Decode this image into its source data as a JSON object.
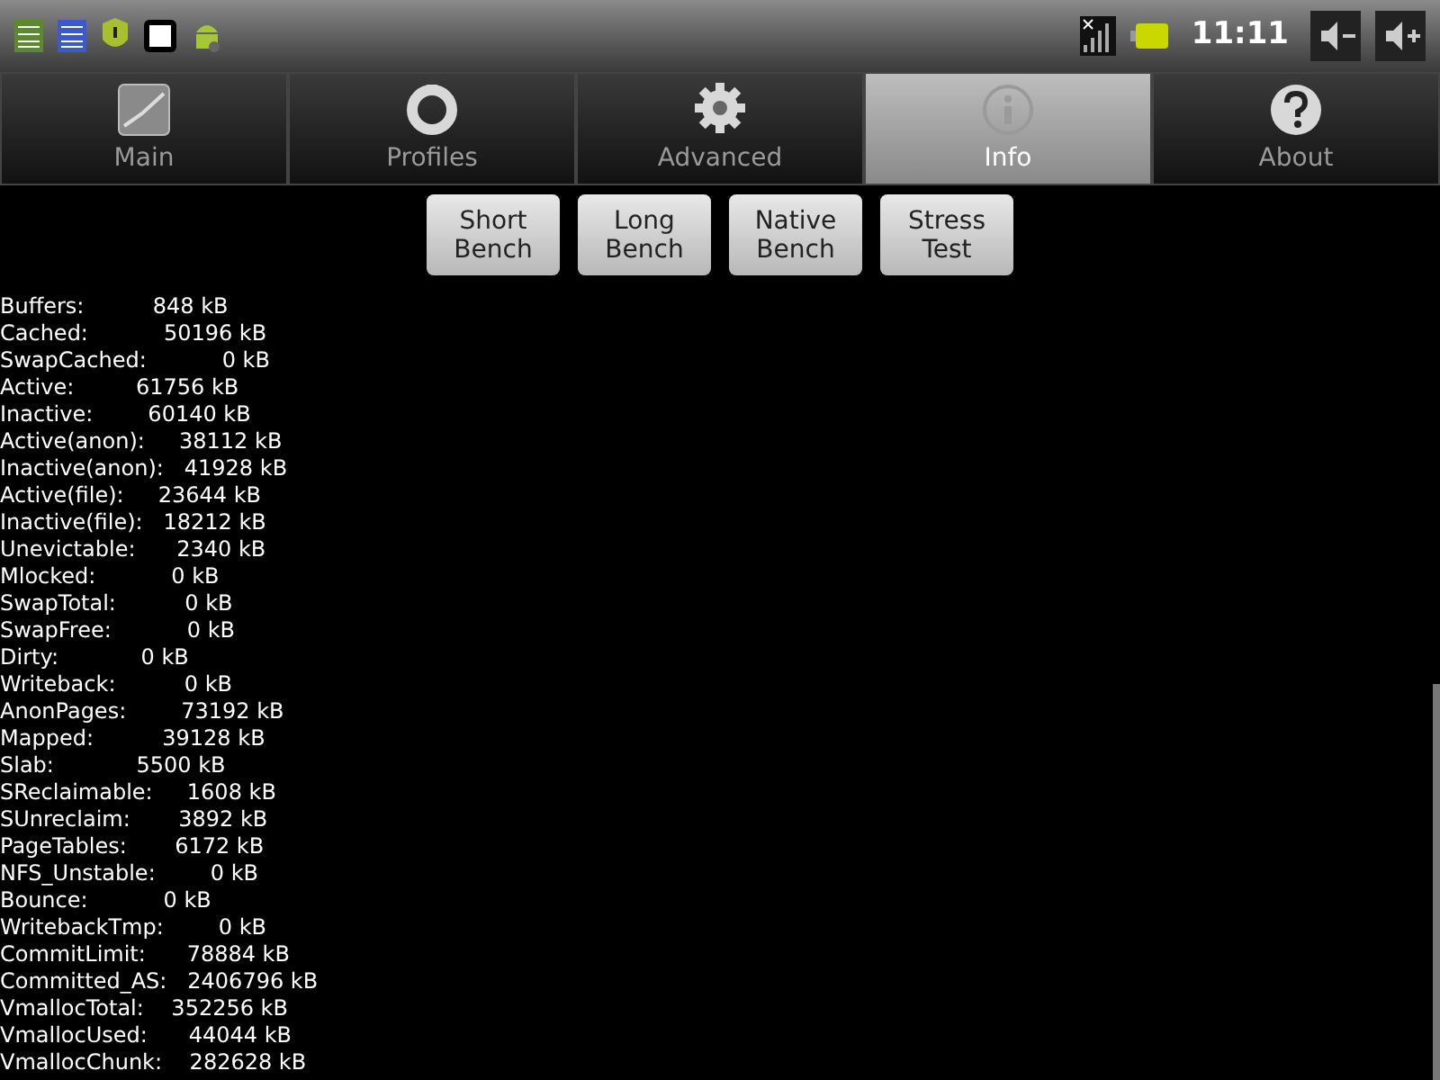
{
  "status_bar": {
    "time": "11:11"
  },
  "tabs": [
    {
      "label": "Main",
      "selected": false,
      "kind": "chart"
    },
    {
      "label": "Profiles",
      "selected": false,
      "kind": "ring"
    },
    {
      "label": "Advanced",
      "selected": false,
      "kind": "gear"
    },
    {
      "label": "Info",
      "selected": true,
      "kind": "info"
    },
    {
      "label": "About",
      "selected": false,
      "kind": "help"
    }
  ],
  "buttons": [
    [
      "Short",
      "Bench"
    ],
    [
      "Long",
      "Bench"
    ],
    [
      "Native",
      "Bench"
    ],
    [
      "Stress",
      "Test"
    ]
  ],
  "lines": [
    "Buffers:          848 kB",
    "Cached:           50196 kB",
    "SwapCached:           0 kB",
    "Active:         61756 kB",
    "Inactive:        60140 kB",
    "Active(anon):     38112 kB",
    "Inactive(anon):   41928 kB",
    "Active(file):     23644 kB",
    "Inactive(file):   18212 kB",
    "Unevictable:      2340 kB",
    "Mlocked:           0 kB",
    "SwapTotal:          0 kB",
    "SwapFree:           0 kB",
    "Dirty:            0 kB",
    "Writeback:          0 kB",
    "AnonPages:        73192 kB",
    "Mapped:          39128 kB",
    "Slab:            5500 kB",
    "SReclaimable:     1608 kB",
    "SUnreclaim:       3892 kB",
    "PageTables:       6172 kB",
    "NFS_Unstable:        0 kB",
    "Bounce:           0 kB",
    "WritebackTmp:        0 kB",
    "CommitLimit:      78884 kB",
    "Committed_AS:   2406796 kB",
    "VmallocTotal:    352256 kB",
    "VmallocUsed:      44044 kB",
    "VmallocChunk:    282628 kB"
  ]
}
